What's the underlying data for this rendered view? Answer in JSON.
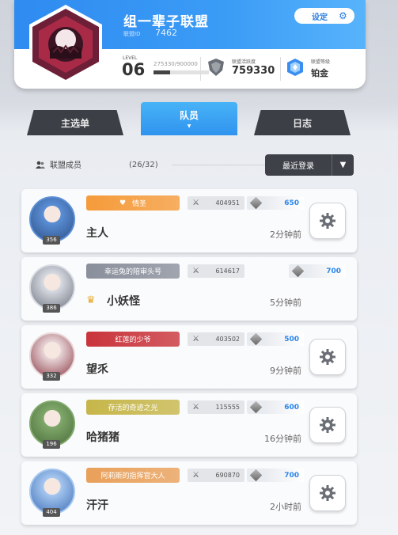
{
  "guild": {
    "name": "组一辈子联盟",
    "id_label": "联盟ID",
    "id": "7462",
    "settings_label": "设定",
    "level_label": "LEVEL",
    "level": "06",
    "exp_text": "275330/900000",
    "exp_fraction": 0.306,
    "activity_label": "联盟活跃度",
    "activity": "759330",
    "rank_label": "联盟等级",
    "rank": "铂金"
  },
  "tabs": [
    {
      "label": "主选单",
      "active": false
    },
    {
      "label": "队员",
      "active": true
    },
    {
      "label": "日志",
      "active": false
    }
  ],
  "members_header": {
    "label": "联盟成员",
    "count": "(26/32)",
    "sort_label": "最近登录"
  },
  "members": [
    {
      "level": "356",
      "title": "情圣",
      "power": "404951",
      "contrib": "650",
      "name": "主人",
      "time": "2分钟前",
      "title_color": "#f59b3a"
    },
    {
      "level": "386",
      "title": "幸运兔的陪审头号",
      "power": "614617",
      "contrib": "700",
      "name": "小妖怪",
      "time": "5分钟前",
      "title_color": "#8a8f9c"
    },
    {
      "level": "332",
      "title": "红莲的少爷",
      "power": "403502",
      "contrib": "500",
      "name": "望乑",
      "time": "9分钟前",
      "title_color": "#c9343b"
    },
    {
      "level": "196",
      "title": "存活的奇迹之光",
      "power": "115555",
      "contrib": "600",
      "name": "哈猪猪",
      "time": "16分钟前",
      "title_color": "#c6b64a"
    },
    {
      "level": "404",
      "title": "阿莉斯的指挥官大人",
      "power": "690870",
      "contrib": "700",
      "name": "汗汗",
      "time": "2小时前",
      "title_color": "#e9a05a"
    }
  ],
  "colors": {
    "accent": "#3b9cf6",
    "tab_dark": "#3c3f45"
  }
}
